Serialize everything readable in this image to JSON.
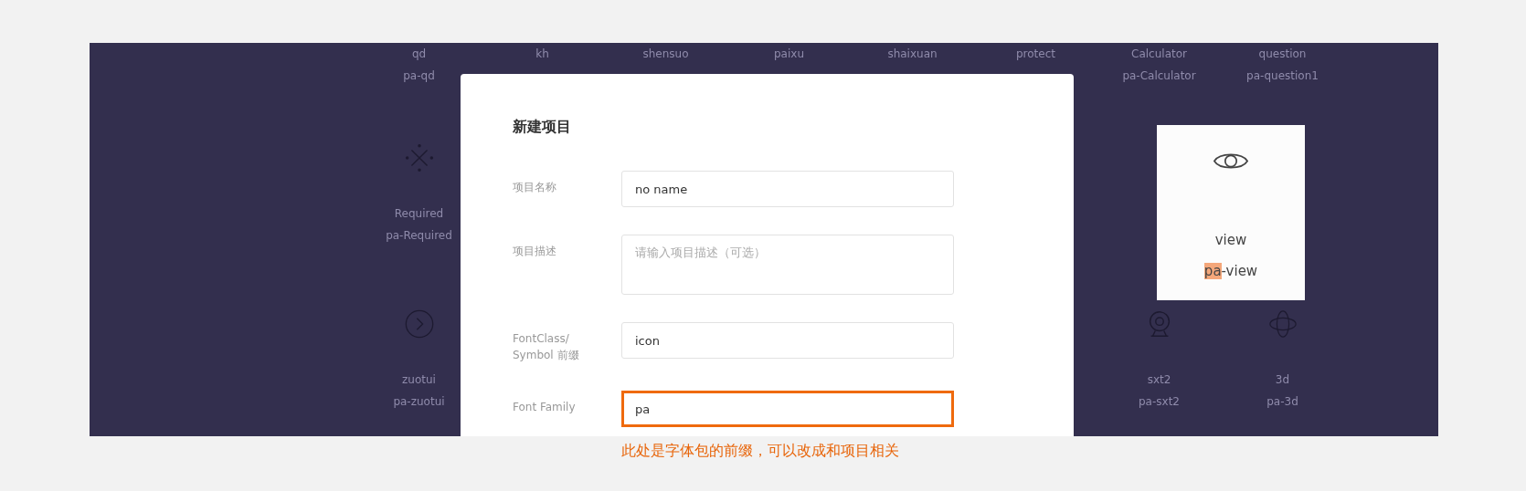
{
  "icon_grid": {
    "top_row": [
      {
        "name": "qd",
        "code": "pa-qd"
      },
      {
        "name": "kh"
      },
      {
        "name": "shensuo"
      },
      {
        "name": "paixu"
      },
      {
        "name": "shaixuan"
      },
      {
        "name": "protect"
      },
      {
        "name": "Calculator",
        "code": "pa-Calculator"
      },
      {
        "name": "question",
        "code": "pa-question1"
      }
    ],
    "icon_items": [
      {
        "name": "Required",
        "code": "pa-Required"
      },
      {
        "name": "zuotui",
        "code": "pa-zuotui"
      },
      {
        "name": "sxt2",
        "code": "pa-sxt2"
      },
      {
        "name": "3d",
        "code": "pa-3d"
      }
    ]
  },
  "modal": {
    "title": "新建项目",
    "fields": [
      {
        "kind": "input",
        "label": "项目名称",
        "value": "no name",
        "highlighted": false
      },
      {
        "kind": "textarea",
        "label": "项目描述",
        "placeholder": "请输入项目描述（可选）",
        "highlighted": false
      },
      {
        "kind": "input",
        "label": "FontClass/ Symbol 前缀",
        "value": "icon",
        "highlighted": false
      },
      {
        "kind": "input",
        "label": "Font Family",
        "value": "pa",
        "highlighted": true
      }
    ]
  },
  "preview_card": {
    "name": "view",
    "code_highlight": "pa",
    "code_rest": "-view"
  },
  "annotation": "此处是字体包的前缀，可以改成和项目相关"
}
